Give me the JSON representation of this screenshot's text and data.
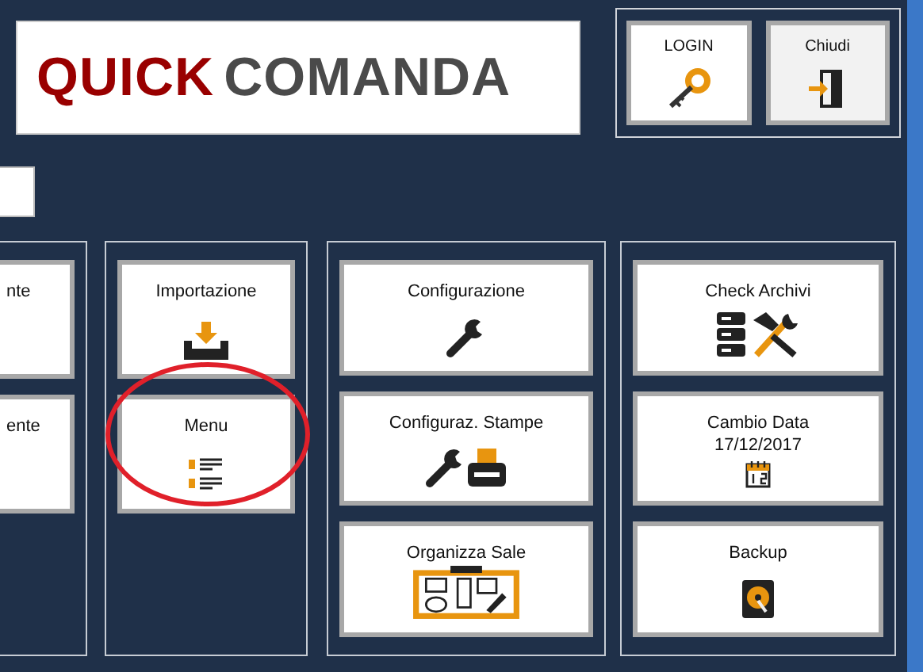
{
  "logo": {
    "part_1": "QUICK",
    "part_2": "COMANDA"
  },
  "top_buttons": [
    {
      "label": "LOGIN",
      "kind": "key",
      "shaded": false
    },
    {
      "label": "Chiudi",
      "kind": "exit",
      "shaded": true
    }
  ],
  "groups": [
    {
      "buttons": [
        {
          "label": "nte",
          "circled": false
        },
        {
          "label": "ente",
          "circled": false
        }
      ]
    },
    {
      "buttons": [
        {
          "label": "Importazione",
          "kind": "download",
          "circled": false
        },
        {
          "label": "Menu",
          "kind": "list",
          "circled": true
        }
      ]
    },
    {
      "buttons": [
        {
          "label": "Configurazione",
          "kind": "wrench",
          "circled": false
        },
        {
          "label": "Configuraz. Stampe",
          "kind": "wrench-printer",
          "circled": false
        },
        {
          "label": "Organizza Sale",
          "kind": "floorplan",
          "circled": false
        }
      ]
    },
    {
      "buttons": [
        {
          "label": "Check Archivi",
          "kind": "db-tools",
          "circled": false
        },
        {
          "label": "Cambio Data",
          "sublabel": "17/12/2017",
          "kind": "calendar",
          "circled": false
        },
        {
          "label": "Backup",
          "kind": "disk",
          "circled": false
        }
      ]
    }
  ]
}
